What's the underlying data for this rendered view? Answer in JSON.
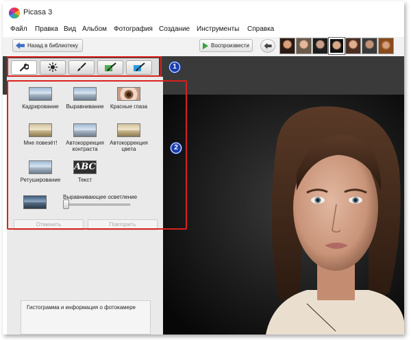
{
  "window": {
    "title": "Picasa 3"
  },
  "menu": [
    "Файл",
    "Правка",
    "Вид",
    "Альбом",
    "Фотография",
    "Создание",
    "Инструменты",
    "Справка"
  ],
  "toolbar": {
    "back_label": "Назад в библиотеку",
    "play_label": "Воспроизвести"
  },
  "tools": [
    {
      "label": "Кадрирование",
      "icon": "crop-icon"
    },
    {
      "label": "Выравнивание",
      "icon": "straighten-icon"
    },
    {
      "label": "Красные глаза",
      "icon": "redeye-icon"
    },
    {
      "label": "Мне повезёт!",
      "icon": "lucky-icon"
    },
    {
      "label": "Автокоррекция контраста",
      "icon": "auto-contrast-icon"
    },
    {
      "label": "Автокоррекция цвета",
      "icon": "auto-color-icon"
    },
    {
      "label": "Ретуширование",
      "icon": "retouch-icon"
    },
    {
      "label": "Текст",
      "icon": "text-icon"
    }
  ],
  "text_icon_label": "ABC",
  "fill_light": {
    "label": "Выравнивающее осветление",
    "value": 0
  },
  "actions": {
    "undo_label": "Отменить",
    "redo_label": "Повторить"
  },
  "histogram": {
    "title": "Гистограмма и информация о фотокамере"
  },
  "callouts": [
    "1",
    "2"
  ],
  "colors": {
    "callout_border": "#d9211d",
    "badge": "#1c3fae",
    "photo_background": "#0e0e0e"
  }
}
